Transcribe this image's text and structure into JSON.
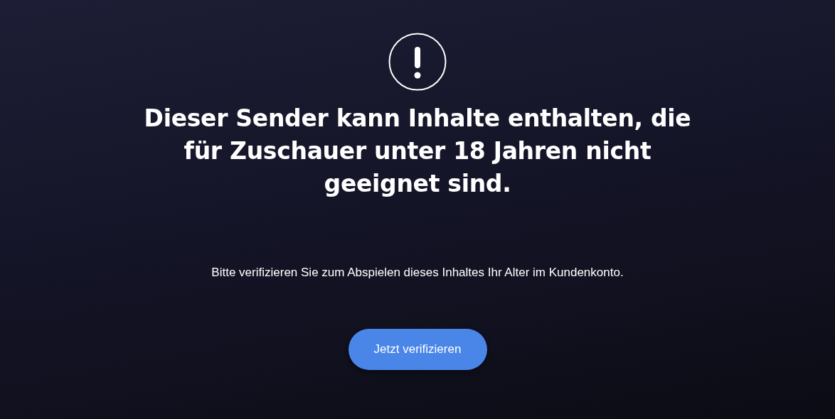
{
  "notice": {
    "heading": "Dieser Sender kann Inhalte enthalten, die für Zuschauer unter 18 Jahren nicht geeignet sind.",
    "message": "Bitte verifizieren Sie zum Abspielen dieses Inhaltes Ihr Alter im Kundenkonto.",
    "button": "Jetzt verifizieren"
  }
}
